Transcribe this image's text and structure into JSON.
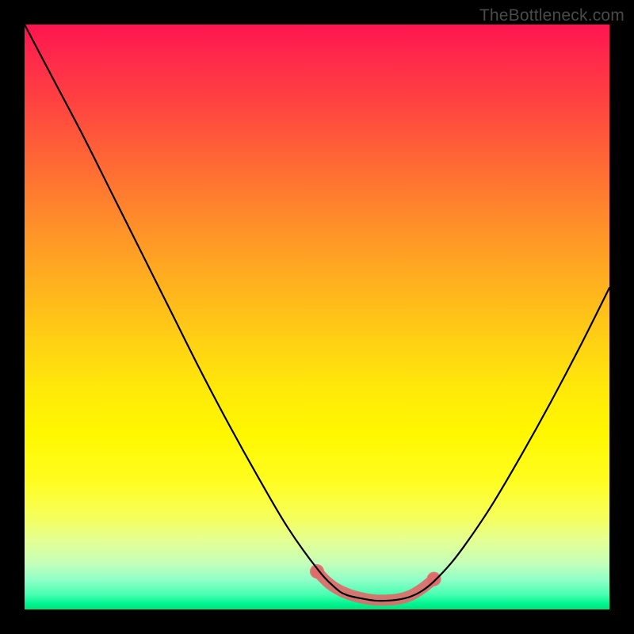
{
  "watermark": "TheBottleneck.com",
  "chart_data": {
    "type": "line",
    "title": "",
    "xlabel": "",
    "ylabel": "",
    "xlim": [
      0,
      100
    ],
    "ylim": [
      0,
      100
    ],
    "grid": false,
    "series": [
      {
        "name": "curve",
        "color": "#000000",
        "x": [
          0,
          5,
          10,
          15,
          20,
          25,
          30,
          35,
          40,
          45,
          50,
          53,
          55,
          58,
          60,
          62,
          64,
          66,
          68,
          70,
          73,
          76,
          80,
          85,
          90,
          95,
          100
        ],
        "y": [
          100,
          90.5,
          81,
          71,
          61,
          51,
          41,
          31.5,
          22.5,
          14,
          7,
          3.8,
          2.5,
          1.8,
          1.5,
          1.5,
          1.7,
          2.2,
          3.2,
          4.8,
          8,
          12,
          18,
          26.5,
          35.5,
          45,
          55
        ]
      },
      {
        "name": "highlight-band",
        "color": "#e06b6b",
        "style": "thick-dots",
        "x": [
          50,
          52,
          54,
          56,
          58,
          60,
          62,
          64,
          66,
          68,
          70
        ],
        "y": [
          6.5,
          4.5,
          3.2,
          2.4,
          1.9,
          1.6,
          1.6,
          1.8,
          2.4,
          3.6,
          5.2
        ]
      }
    ],
    "background_gradient": {
      "direction": "vertical",
      "stops": [
        {
          "pos": 0.0,
          "color": "#ff1450"
        },
        {
          "pos": 0.5,
          "color": "#ffd014"
        },
        {
          "pos": 0.8,
          "color": "#f0ff60"
        },
        {
          "pos": 1.0,
          "color": "#00e27a"
        }
      ]
    }
  }
}
